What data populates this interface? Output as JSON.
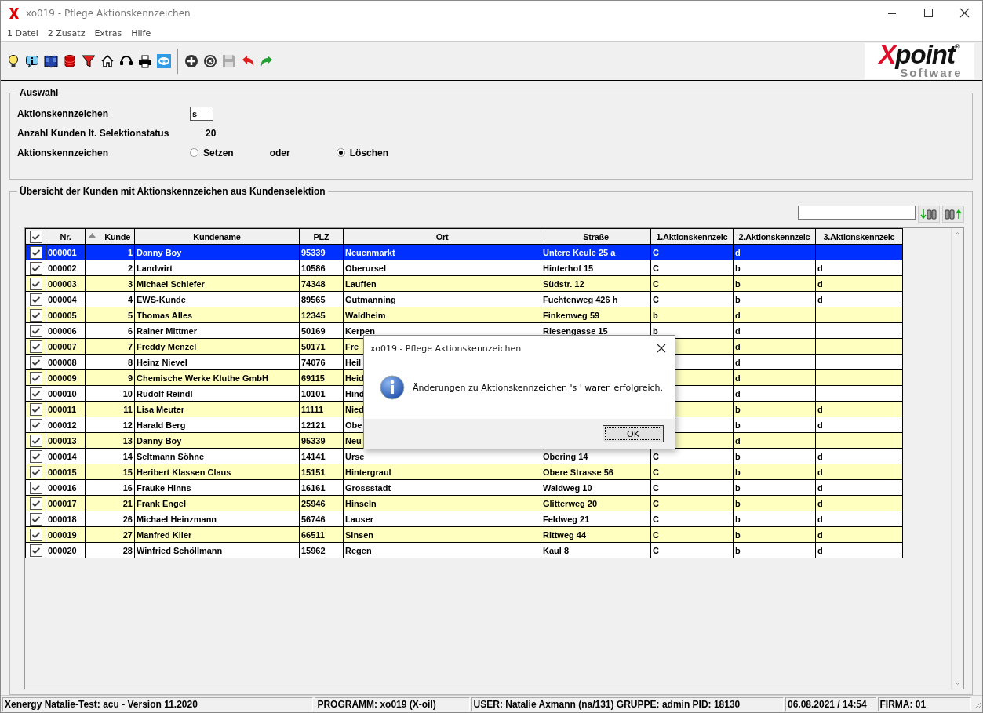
{
  "window": {
    "title": "xo019 - Pflege Aktionskennzeichen"
  },
  "menu": [
    "1 Datei",
    "2 Zusatz",
    "Extras",
    "Hilfe"
  ],
  "logo": {
    "wordmark": "Xpoint",
    "registered": "®",
    "tagline": "Software"
  },
  "auswahl": {
    "legend": "Auswahl",
    "fields": [
      {
        "kind": "input",
        "label": "Aktionskennzeichen",
        "value": "s"
      },
      {
        "kind": "value",
        "label": "Anzahl Kunden lt. Selektionstatus",
        "value": "20"
      },
      {
        "kind": "radio",
        "label": "Aktionskennzeichen",
        "separator": "oder",
        "options": [
          {
            "label": "Setzen",
            "selected": false
          },
          {
            "label": "Löschen",
            "selected": true
          }
        ]
      }
    ]
  },
  "overview": {
    "legend": "Übersicht der Kunden mit Aktionskennzeichen aus Kundenselektion",
    "columns": [
      {
        "kind": "check",
        "checked": true
      },
      {
        "label": "Nr."
      },
      {
        "label": "Kunde",
        "sorted": true
      },
      {
        "label": "Kundename"
      },
      {
        "label": "PLZ"
      },
      {
        "label": "Ort"
      },
      {
        "label": "Straße"
      },
      {
        "label": "1.Aktionskennzeic"
      },
      {
        "label": "2.Aktionskennzeic"
      },
      {
        "label": "3.Aktionskennzeic"
      }
    ],
    "rows": [
      {
        "checked": true,
        "selected": true,
        "nr": "000001",
        "kunde": "1",
        "name": "Danny Boy",
        "plz": "95339",
        "ort": "Neuenmarkt",
        "strasse": "Untere Keule 25 a",
        "a1": "C",
        "a2": "d"
      },
      {
        "checked": true,
        "selected": false,
        "nr": "000002",
        "kunde": "2",
        "name": "Landwirt",
        "plz": "10586",
        "ort": "Oberursel",
        "strasse": "Hinterhof 15",
        "a1": "C",
        "a2": "b",
        "a3": "d"
      },
      {
        "checked": true,
        "selected": false,
        "nr": "000003",
        "kunde": "3",
        "name": "Michael Schiefer",
        "plz": "74348",
        "ort": "Lauffen",
        "strasse": "Südstr. 12",
        "a1": "C",
        "a2": "b",
        "a3": "d"
      },
      {
        "checked": true,
        "selected": false,
        "nr": "000004",
        "kunde": "4",
        "name": "EWS-Kunde",
        "plz": "89565",
        "ort": "Gutmanning",
        "strasse": "Fuchtenweg 426 h",
        "a1": "C",
        "a2": "b",
        "a3": "d"
      },
      {
        "checked": true,
        "selected": false,
        "nr": "000005",
        "kunde": "5",
        "name": "Thomas Alles",
        "plz": "12345",
        "ort": "Waldheim",
        "strasse": "Finkenweg 59",
        "a1": "b",
        "a2": "d"
      },
      {
        "checked": true,
        "selected": false,
        "nr": "000006",
        "kunde": "6",
        "name": "Rainer Mittmer",
        "plz": "50169",
        "ort": "Kerpen",
        "strasse": "Riesengasse 15",
        "a1": "b",
        "a2": "d"
      },
      {
        "checked": true,
        "selected": false,
        "nr": "000007",
        "kunde": "7",
        "name": "Freddy Menzel",
        "plz": "50171",
        "ort": "Fre",
        "a2": "d"
      },
      {
        "checked": true,
        "selected": false,
        "nr": "000008",
        "kunde": "8",
        "name": "Heinz Nievel",
        "plz": "74076",
        "ort": "Heil",
        "a2": "d"
      },
      {
        "checked": true,
        "selected": false,
        "nr": "000009",
        "kunde": "9",
        "name": "Chemische Werke Kluthe GmbH",
        "plz": "69115",
        "ort": "Heid",
        "a2": "d"
      },
      {
        "checked": true,
        "selected": false,
        "nr": "000010",
        "kunde": "10",
        "name": "Rudolf Reindl",
        "plz": "10101",
        "ort": "Hind",
        "a2": "d"
      },
      {
        "checked": true,
        "selected": false,
        "nr": "000011",
        "kunde": "11",
        "name": "Lisa Meuter",
        "plz": "11111",
        "ort": "Nied",
        "a2": "b",
        "a3": "d"
      },
      {
        "checked": true,
        "selected": false,
        "nr": "000012",
        "kunde": "12",
        "name": "Harald Berg",
        "plz": "12121",
        "ort": "Obe",
        "a2": "b",
        "a3": "d"
      },
      {
        "checked": true,
        "selected": false,
        "nr": "000013",
        "kunde": "13",
        "name": "Danny Boy",
        "plz": "95339",
        "ort": "Neu",
        "a2": "d"
      },
      {
        "checked": true,
        "selected": false,
        "nr": "000014",
        "kunde": "14",
        "name": "Seltmann Söhne",
        "plz": "14141",
        "ort": "Urse",
        "strasse": "Obering 14",
        "a1": "C",
        "a2": "b",
        "a3": "d"
      },
      {
        "checked": true,
        "selected": false,
        "nr": "000015",
        "kunde": "15",
        "name": "Heribert Klassen Claus",
        "plz": "15151",
        "ort": "Hintergraul",
        "strasse": "Obere Strasse 56",
        "a1": "C",
        "a2": "b",
        "a3": "d"
      },
      {
        "checked": true,
        "selected": false,
        "nr": "000016",
        "kunde": "16",
        "name": "Frauke Hinns",
        "plz": "16161",
        "ort": "Grossstadt",
        "strasse": "Waldweg 10",
        "a1": "C",
        "a2": "b",
        "a3": "d"
      },
      {
        "checked": true,
        "selected": false,
        "nr": "000017",
        "kunde": "21",
        "name": "Frank Engel",
        "plz": "25946",
        "ort": "Hinseln",
        "strasse": "Glitterweg 20",
        "a1": "C",
        "a2": "b",
        "a3": "d"
      },
      {
        "checked": true,
        "selected": false,
        "nr": "000018",
        "kunde": "26",
        "name": "Michael Heinzmann",
        "plz": "56746",
        "ort": "Lauser",
        "strasse": "Feldweg 21",
        "a1": "C",
        "a2": "b",
        "a3": "d"
      },
      {
        "checked": true,
        "selected": false,
        "nr": "000019",
        "kunde": "27",
        "name": "Manfred Klier",
        "plz": "66511",
        "ort": "Sinsen",
        "strasse": "Rittweg 44",
        "a1": "C",
        "a2": "b",
        "a3": "d"
      },
      {
        "checked": true,
        "selected": false,
        "nr": "000020",
        "kunde": "28",
        "name": "Winfried Schöllmann",
        "plz": "15962",
        "ort": "Regen",
        "strasse": "Kaul 8",
        "a1": "C",
        "a2": "b",
        "a3": "d"
      }
    ]
  },
  "dialog": {
    "title": "xo019 - Pflege Aktionskennzeichen",
    "message": "Änderungen zu Aktionskennzeichen 's '  waren erfolgreich.",
    "button": "OK"
  },
  "status_bar": [
    "Xenergy Natalie-Test: acu - Version 11.2020",
    "PROGRAMM: xo019 (X-oil)",
    "USER: Natalie Axmann (na/131)  GRUPPE: admin  PID: 18130",
    "06.08.2021 / 14:54",
    "FIRMA: 01"
  ]
}
